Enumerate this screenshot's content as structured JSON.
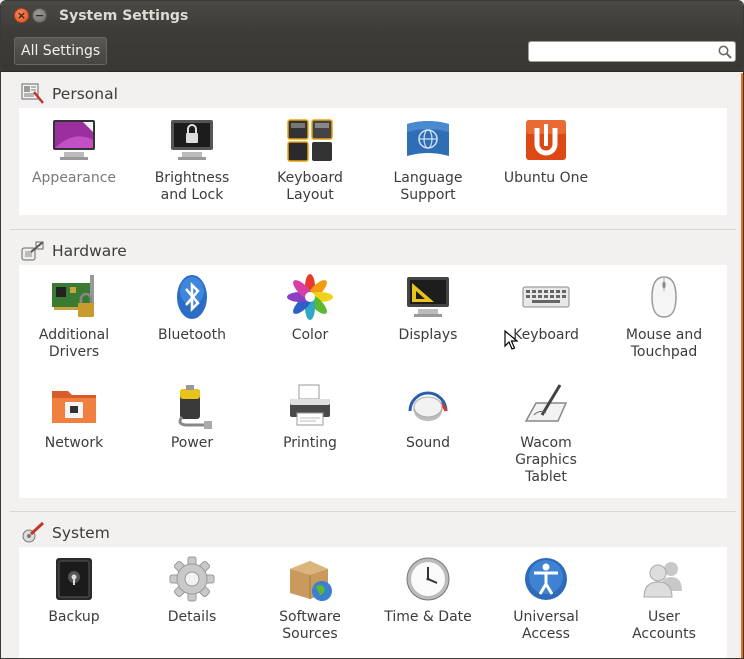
{
  "window": {
    "title": "System Settings",
    "close_glyph": "×",
    "min_glyph": "−"
  },
  "toolbar": {
    "all_settings_label": "All Settings",
    "search_placeholder": "",
    "search_value": ""
  },
  "sections": {
    "personal": {
      "title": "Personal",
      "icon": "personal-section-icon",
      "items": [
        {
          "label": "Appearance",
          "icon": "appearance-icon"
        },
        {
          "label": "Brightness\nand Lock",
          "icon": "brightness-lock-icon"
        },
        {
          "label": "Keyboard\nLayout",
          "icon": "keyboard-layout-icon"
        },
        {
          "label": "Language\nSupport",
          "icon": "language-support-icon"
        },
        {
          "label": "Ubuntu One",
          "icon": "ubuntu-one-icon"
        }
      ]
    },
    "hardware": {
      "title": "Hardware",
      "icon": "hardware-section-icon",
      "items": [
        {
          "label": "Additional\nDrivers",
          "icon": "additional-drivers-icon"
        },
        {
          "label": "Bluetooth",
          "icon": "bluetooth-icon"
        },
        {
          "label": "Color",
          "icon": "color-icon"
        },
        {
          "label": "Displays",
          "icon": "displays-icon"
        },
        {
          "label": "Keyboard",
          "icon": "keyboard-icon"
        },
        {
          "label": "Mouse and\nTouchpad",
          "icon": "mouse-icon"
        },
        {
          "label": "Network",
          "icon": "network-icon"
        },
        {
          "label": "Power",
          "icon": "power-icon"
        },
        {
          "label": "Printing",
          "icon": "printer-icon"
        },
        {
          "label": "Sound",
          "icon": "sound-icon"
        },
        {
          "label": "Wacom\nGraphics\nTablet",
          "icon": "wacom-tablet-icon"
        }
      ]
    },
    "system": {
      "title": "System",
      "icon": "system-section-icon",
      "items": [
        {
          "label": "Backup",
          "icon": "backup-icon"
        },
        {
          "label": "Details",
          "icon": "details-gear-icon"
        },
        {
          "label": "Software\nSources",
          "icon": "software-sources-icon"
        },
        {
          "label": "Time & Date",
          "icon": "clock-icon"
        },
        {
          "label": "Universal\nAccess",
          "icon": "universal-access-icon"
        },
        {
          "label": "User\nAccounts",
          "icon": "user-accounts-icon"
        }
      ]
    }
  },
  "colors": {
    "accent": "#e66e22",
    "titlebar": "#3d3c38",
    "panel": "#ffffff",
    "background": "#f2f1f0"
  }
}
